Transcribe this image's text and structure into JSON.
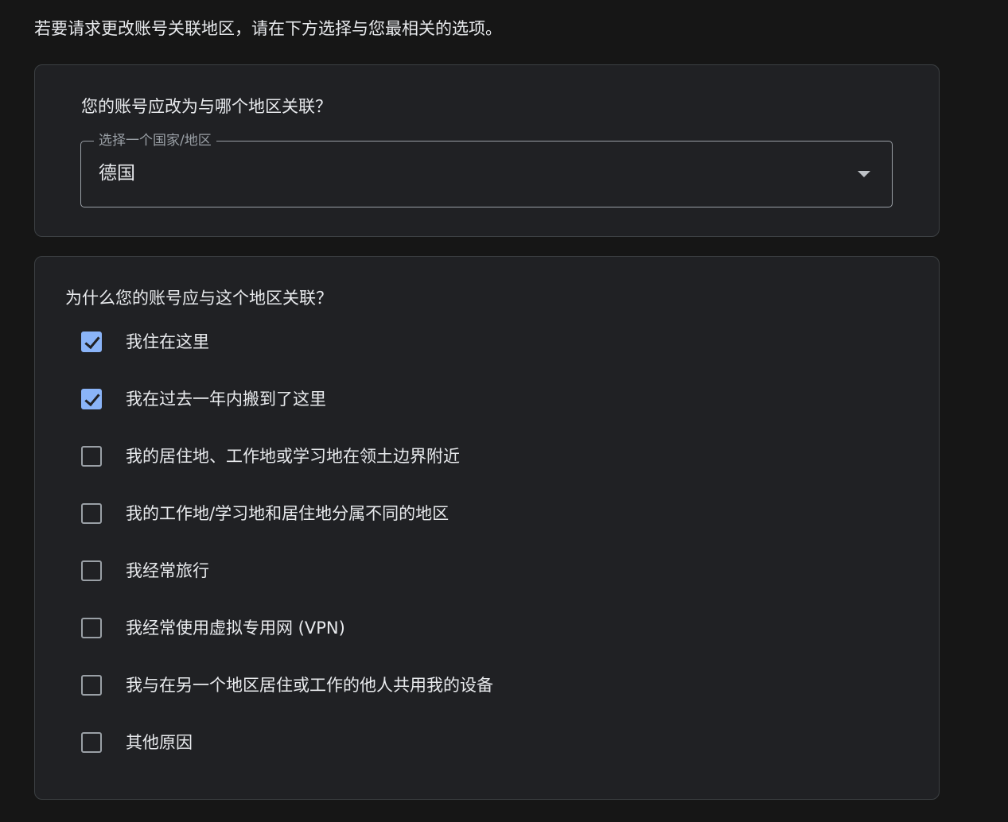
{
  "intro_text": "若要请求更改账号关联地区，请在下方选择与您最相关的选项。",
  "region_card": {
    "question": "您的账号应改为与哪个地区关联？",
    "select": {
      "label": "选择一个国家/地区",
      "value": "德国",
      "icon": "dropdown-arrow-icon"
    }
  },
  "reason_card": {
    "question": "为什么您的账号应与这个地区关联？",
    "options": [
      {
        "label": "我住在这里",
        "checked": true
      },
      {
        "label": "我在过去一年内搬到了这里",
        "checked": true
      },
      {
        "label": "我的居住地、工作地或学习地在领土边界附近",
        "checked": false
      },
      {
        "label": "我的工作地/学习地和居住地分属不同的地区",
        "checked": false
      },
      {
        "label": "我经常旅行",
        "checked": false
      },
      {
        "label": "我经常使用虚拟专用网 (VPN)",
        "checked": false
      },
      {
        "label": "我与在另一个地区居住或工作的他人共用我的设备",
        "checked": false
      },
      {
        "label": "其他原因",
        "checked": false
      }
    ]
  },
  "colors": {
    "background": "#161616",
    "card": "#202124",
    "accent": "#8ab4f8"
  }
}
